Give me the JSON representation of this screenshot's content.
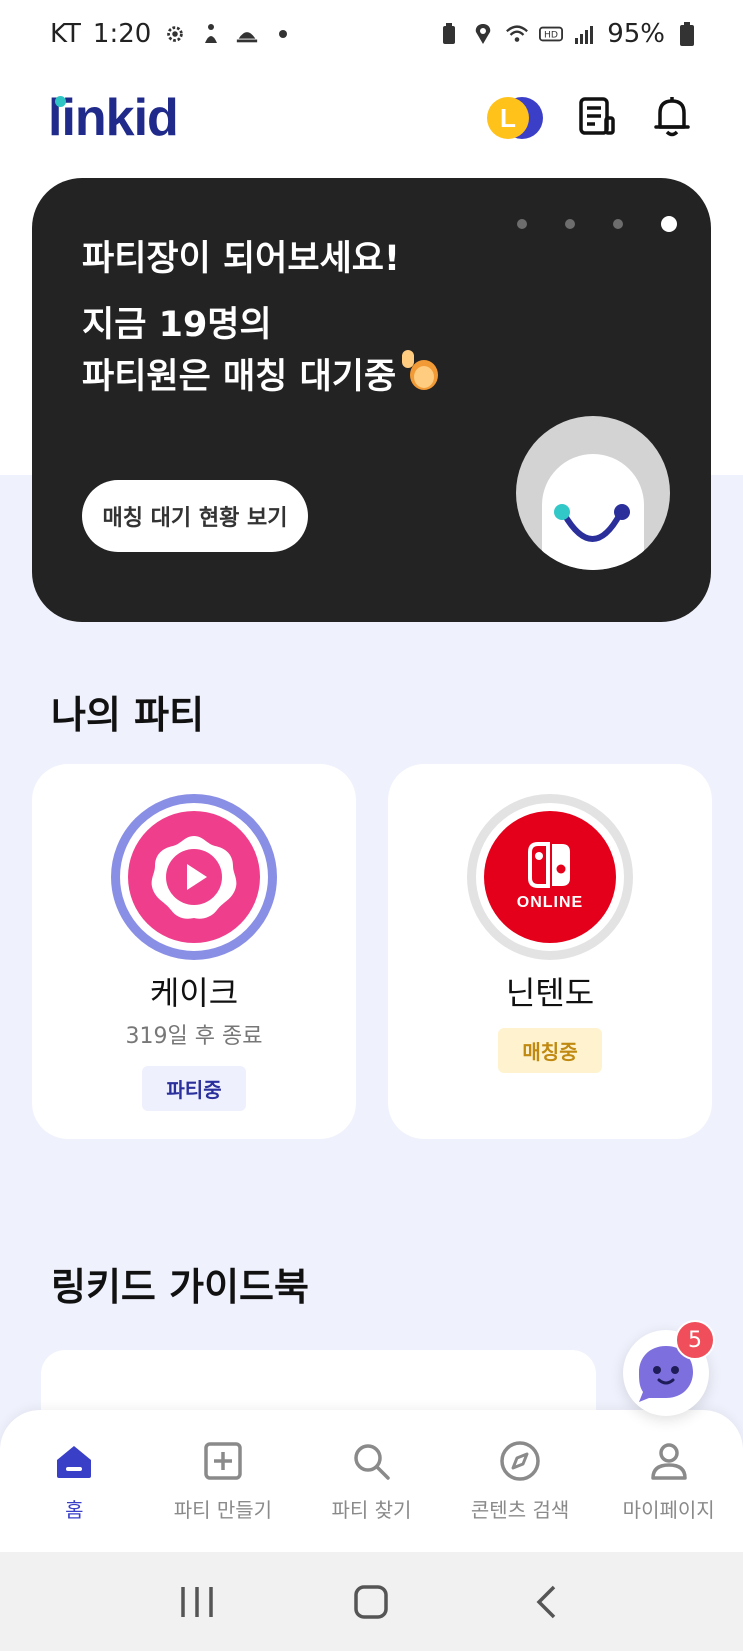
{
  "status_bar": {
    "carrier": "KT",
    "time": "1:20",
    "battery": "95%"
  },
  "header": {
    "logo": "linkid",
    "point_letter": "L"
  },
  "banner": {
    "title": "파티장이 되어보세요!",
    "subtitle_line1": "지금 19명의",
    "subtitle_line2": "파티원은 매칭 대기중",
    "button_label": "매칭 대기 현황 보기",
    "slide_count": 4,
    "active_slide": 4
  },
  "my_party": {
    "title": "나의 파티",
    "cards": [
      {
        "name": "케이크",
        "meta": "319일 후 종료",
        "badge": "파티중"
      },
      {
        "name": "닌텐도",
        "badge": "매칭중",
        "logo_text": "ONLINE"
      }
    ]
  },
  "guide": {
    "title": "링키드 가이드북"
  },
  "chat": {
    "badge_count": "5"
  },
  "bottom_nav": {
    "items": [
      {
        "label": "홈",
        "icon": "home-icon"
      },
      {
        "label": "파티 만들기",
        "icon": "plus-square-icon"
      },
      {
        "label": "파티 찾기",
        "icon": "search-icon"
      },
      {
        "label": "콘텐츠 검색",
        "icon": "compass-icon"
      },
      {
        "label": "마이페이지",
        "icon": "user-icon"
      }
    ]
  },
  "colors": {
    "brand": "#1f2a8a",
    "accent": "#3a3fc7",
    "banner_bg": "#232323",
    "page_bg": "#eff1fc",
    "badge_active_bg": "#eef0fd",
    "badge_matching_bg": "#fff3cf",
    "badge_matching_text": "#c08a12",
    "notification_red": "#ef4e5a"
  }
}
